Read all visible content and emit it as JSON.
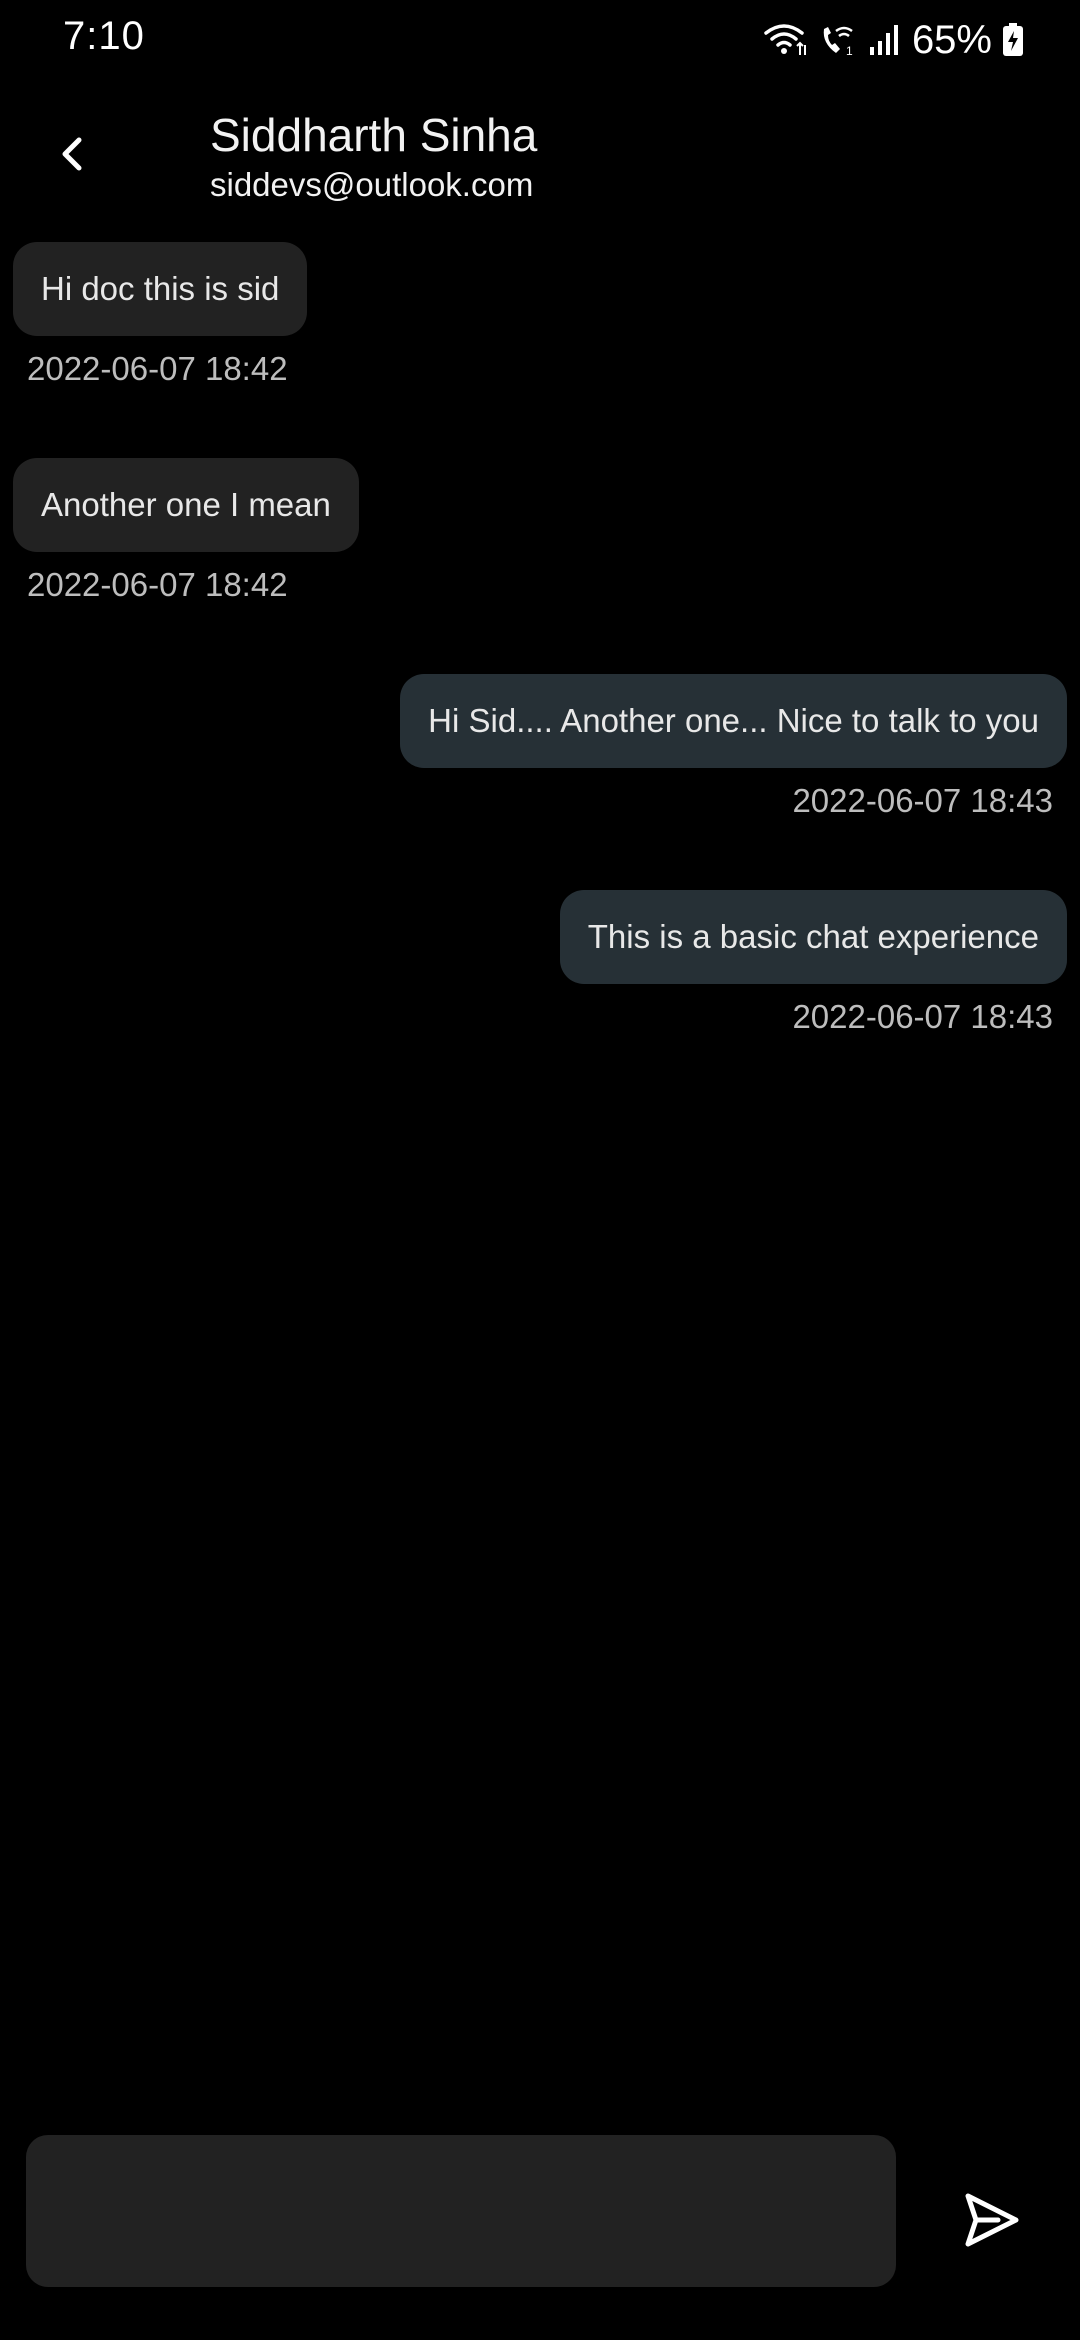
{
  "status_bar": {
    "time": "7:10",
    "battery_percent": "65%",
    "icons": [
      "wifi-icon",
      "wifi-calling-icon",
      "signal-icon",
      "battery-charging-icon"
    ]
  },
  "header": {
    "back_icon": "chevron-left-icon",
    "contact_name": "Siddharth Sinha",
    "contact_email": "siddevs@outlook.com"
  },
  "messages": [
    {
      "direction": "incoming",
      "text": "Hi doc this is sid",
      "timestamp": "2022-06-07 18:42"
    },
    {
      "direction": "incoming",
      "text": "Another one I mean",
      "timestamp": "2022-06-07 18:42"
    },
    {
      "direction": "outgoing",
      "text": "Hi Sid.... Another one... Nice to talk to you",
      "timestamp": "2022-06-07 18:43"
    },
    {
      "direction": "outgoing",
      "text": "This is a basic chat experience",
      "timestamp": "2022-06-07 18:43"
    }
  ],
  "composer": {
    "value": "",
    "placeholder": "",
    "send_icon": "send-icon"
  },
  "colors": {
    "background": "#000000",
    "incoming_bubble": "#222222",
    "outgoing_bubble": "#263036",
    "input_background": "#222222",
    "timestamp_text": "#bdbdbd"
  }
}
